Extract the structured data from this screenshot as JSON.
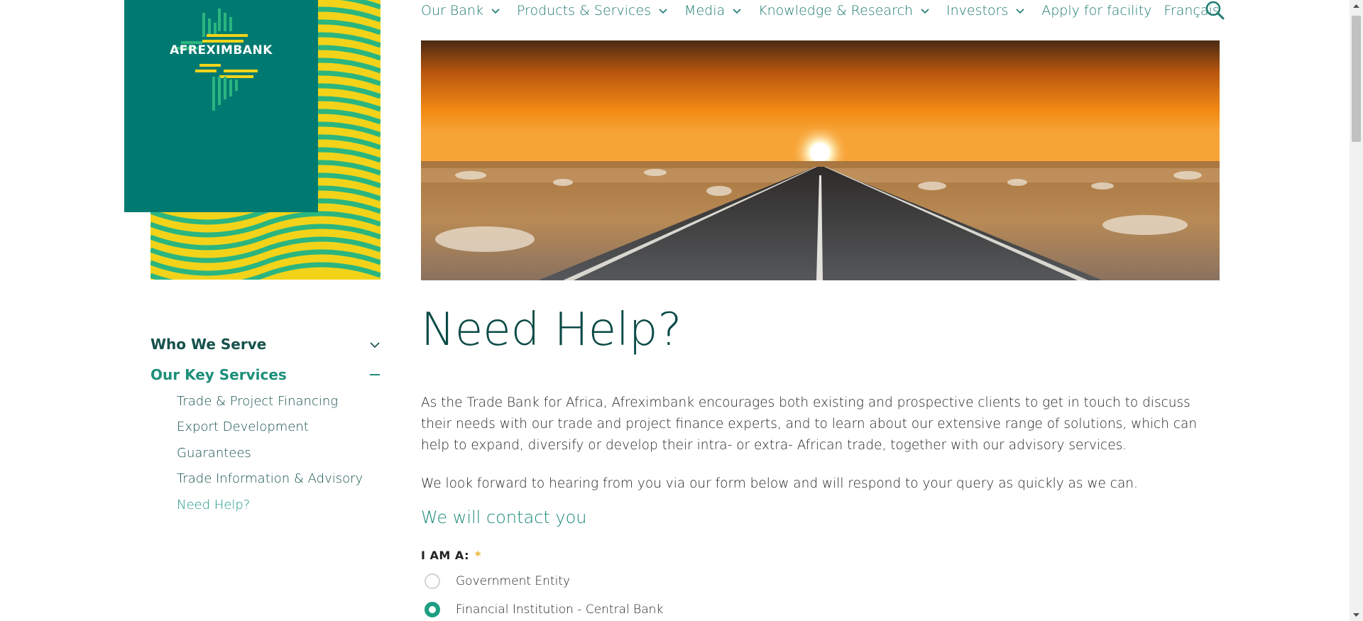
{
  "brand": {
    "name": "AFREXIMBANK",
    "colors": {
      "teal": "#007a70",
      "yellow": "#f2d31a",
      "green": "#2bb57f"
    }
  },
  "nav": {
    "items": [
      {
        "label": "Our Bank",
        "dropdown": true
      },
      {
        "label": "Products & Services",
        "dropdown": true
      },
      {
        "label": "Media",
        "dropdown": true
      },
      {
        "label": "Knowledge & Research",
        "dropdown": true
      },
      {
        "label": "Investors",
        "dropdown": true
      },
      {
        "label": "Apply for facility",
        "dropdown": false
      },
      {
        "label": "Français",
        "dropdown": false
      }
    ],
    "search_icon": "search-icon"
  },
  "sidebar": {
    "sections": [
      {
        "label": "Who We Serve",
        "expanded": false
      },
      {
        "label": "Our Key Services",
        "expanded": true
      }
    ],
    "sub_items": [
      {
        "label": "Trade & Project Financing"
      },
      {
        "label": "Export Development"
      },
      {
        "label": "Guarantees"
      },
      {
        "label": "Trade Information & Advisory"
      },
      {
        "label": "Need Help?"
      }
    ],
    "current": "Need Help?"
  },
  "main": {
    "title": "Need Help?",
    "intro_1": "As the Trade Bank for Africa, Afreximbank encourages both existing and prospective clients to get in touch to discuss their needs with our trade and project finance experts, and to learn about our extensive range of solutions, which can help to expand, diversify or develop their intra- or extra- African trade, together with our advisory services.",
    "intro_2": "We look forward to hearing from you via our form below and will respond to your query as quickly as we can.",
    "contact_heading": "We will contact you"
  },
  "form": {
    "iam_label": "I AM A:",
    "required_mark": "*",
    "options": [
      {
        "label": "Government Entity",
        "checked": false
      },
      {
        "label": "Financial Institution - Central Bank",
        "checked": true
      }
    ]
  },
  "colors": {
    "accent": "#1d8a78",
    "title": "#0b4a46",
    "radio_checked": "#1e9e82"
  }
}
